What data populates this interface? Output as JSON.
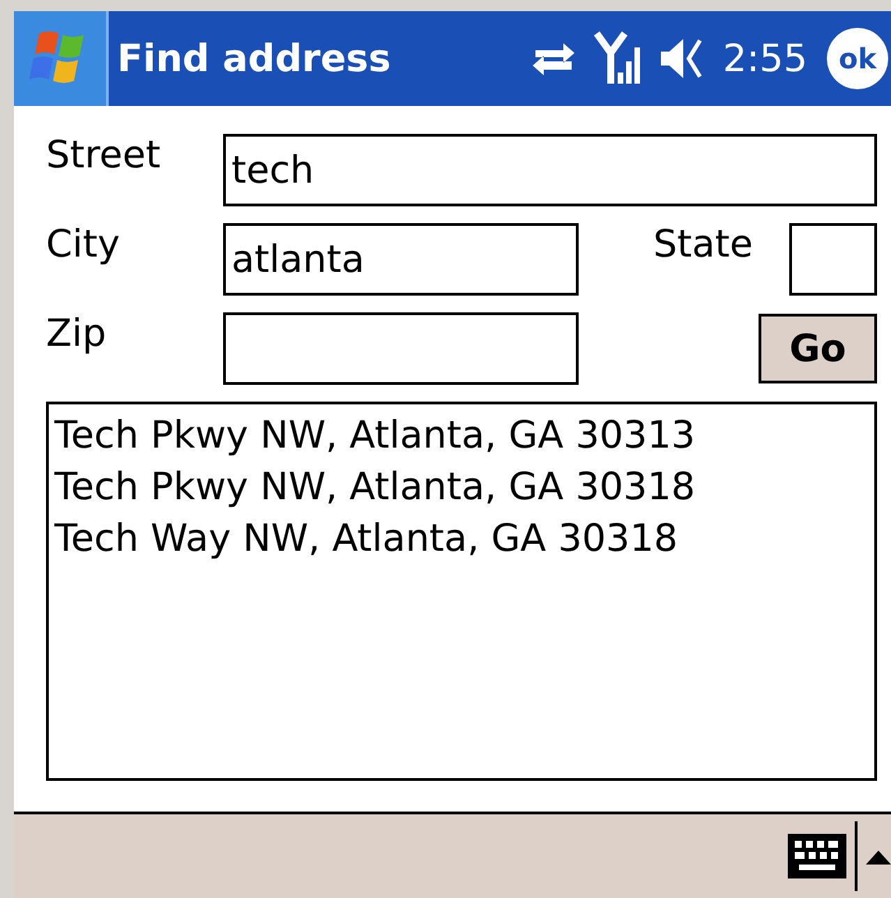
{
  "title_bar": {
    "title": "Find address",
    "clock": "2:55",
    "ok_button": "ok"
  },
  "form": {
    "street": {
      "label": "Street",
      "value": "tech"
    },
    "city": {
      "label": "City",
      "value": "atlanta"
    },
    "state": {
      "label": "State"
    },
    "zip": {
      "label": "Zip"
    },
    "go_button": "Go"
  },
  "results": [
    "Tech Pkwy NW, Atlanta, GA 30313",
    "Tech Pkwy NW, Atlanta, GA 30318",
    "Tech Way NW, Atlanta, GA 30318"
  ]
}
